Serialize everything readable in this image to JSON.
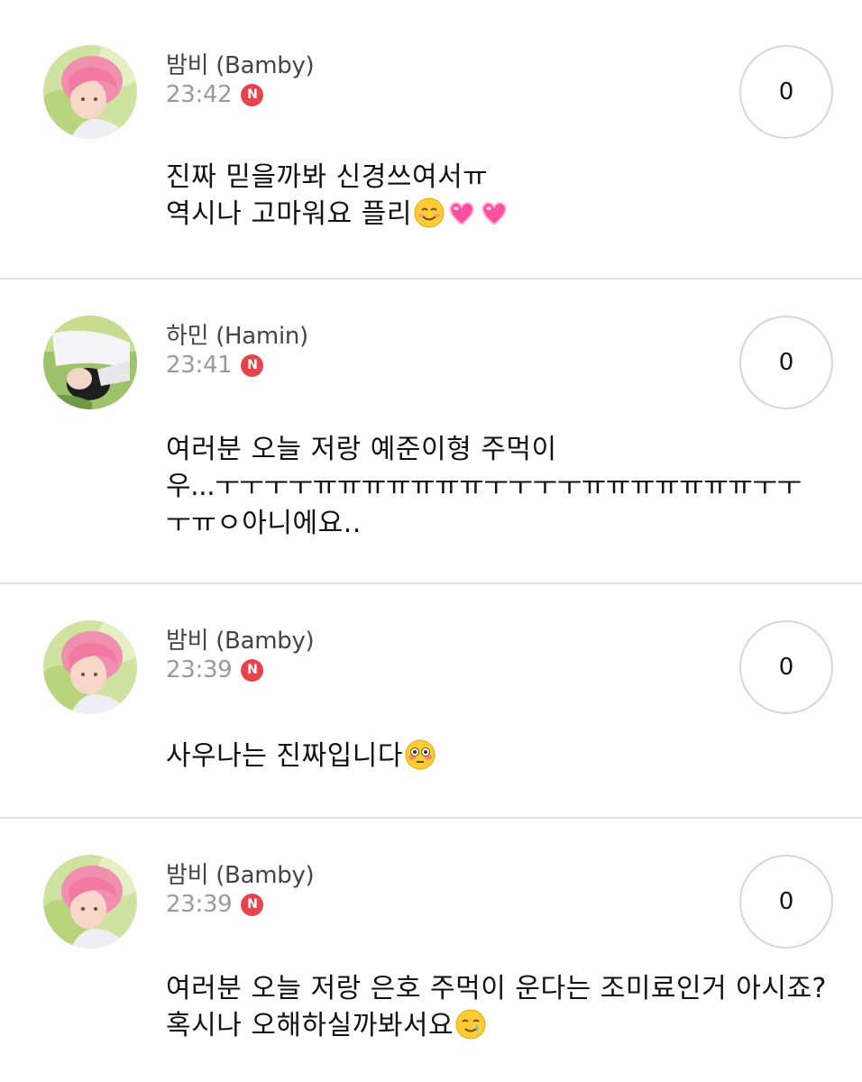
{
  "comments": [
    {
      "author": "밤비 (Bamby)",
      "time": "23:42",
      "badge": "N",
      "likes": "0",
      "lines": [
        "진짜 믿을까봐 신경쓰여서ㅠ",
        "역시나 고마워요 플리"
      ],
      "emojis": [
        "smiling-face-icon",
        "heart-icon",
        "heart-icon"
      ]
    },
    {
      "author": "하민 (Hamin)",
      "time": "23:41",
      "badge": "N",
      "likes": "0",
      "lines": [
        "여러분 오늘 저랑 예준이형 주먹이",
        "우...ㅜㅜㅜㅜㅠㅠㅠㅠㅠㅠㅠㅜㅜㅜㅜㅠㅠㅠㅠㅠㅠㅠㅜㅜ",
        "ㅜㅠㅇ아니에요.."
      ],
      "emojis": []
    },
    {
      "author": "밤비 (Bamby)",
      "time": "23:39",
      "badge": "N",
      "likes": "0",
      "lines": [
        "사우나는 진짜입니다"
      ],
      "emojis": [
        "flushed-face-icon"
      ]
    },
    {
      "author": "밤비 (Bamby)",
      "time": "23:39",
      "badge": "N",
      "likes": "0",
      "lines": [
        "여러분 오늘 저랑 은호 주먹이 운다는 조미료인거 아시죠?",
        "혹시나 오해하실까봐서요"
      ],
      "emojis": [
        "smiling-face-with-tear-icon"
      ]
    }
  ],
  "colors": {
    "badge": "#e8424a",
    "divider": "#e2e2e2",
    "time": "#9a9a9a",
    "author": "#444444"
  }
}
